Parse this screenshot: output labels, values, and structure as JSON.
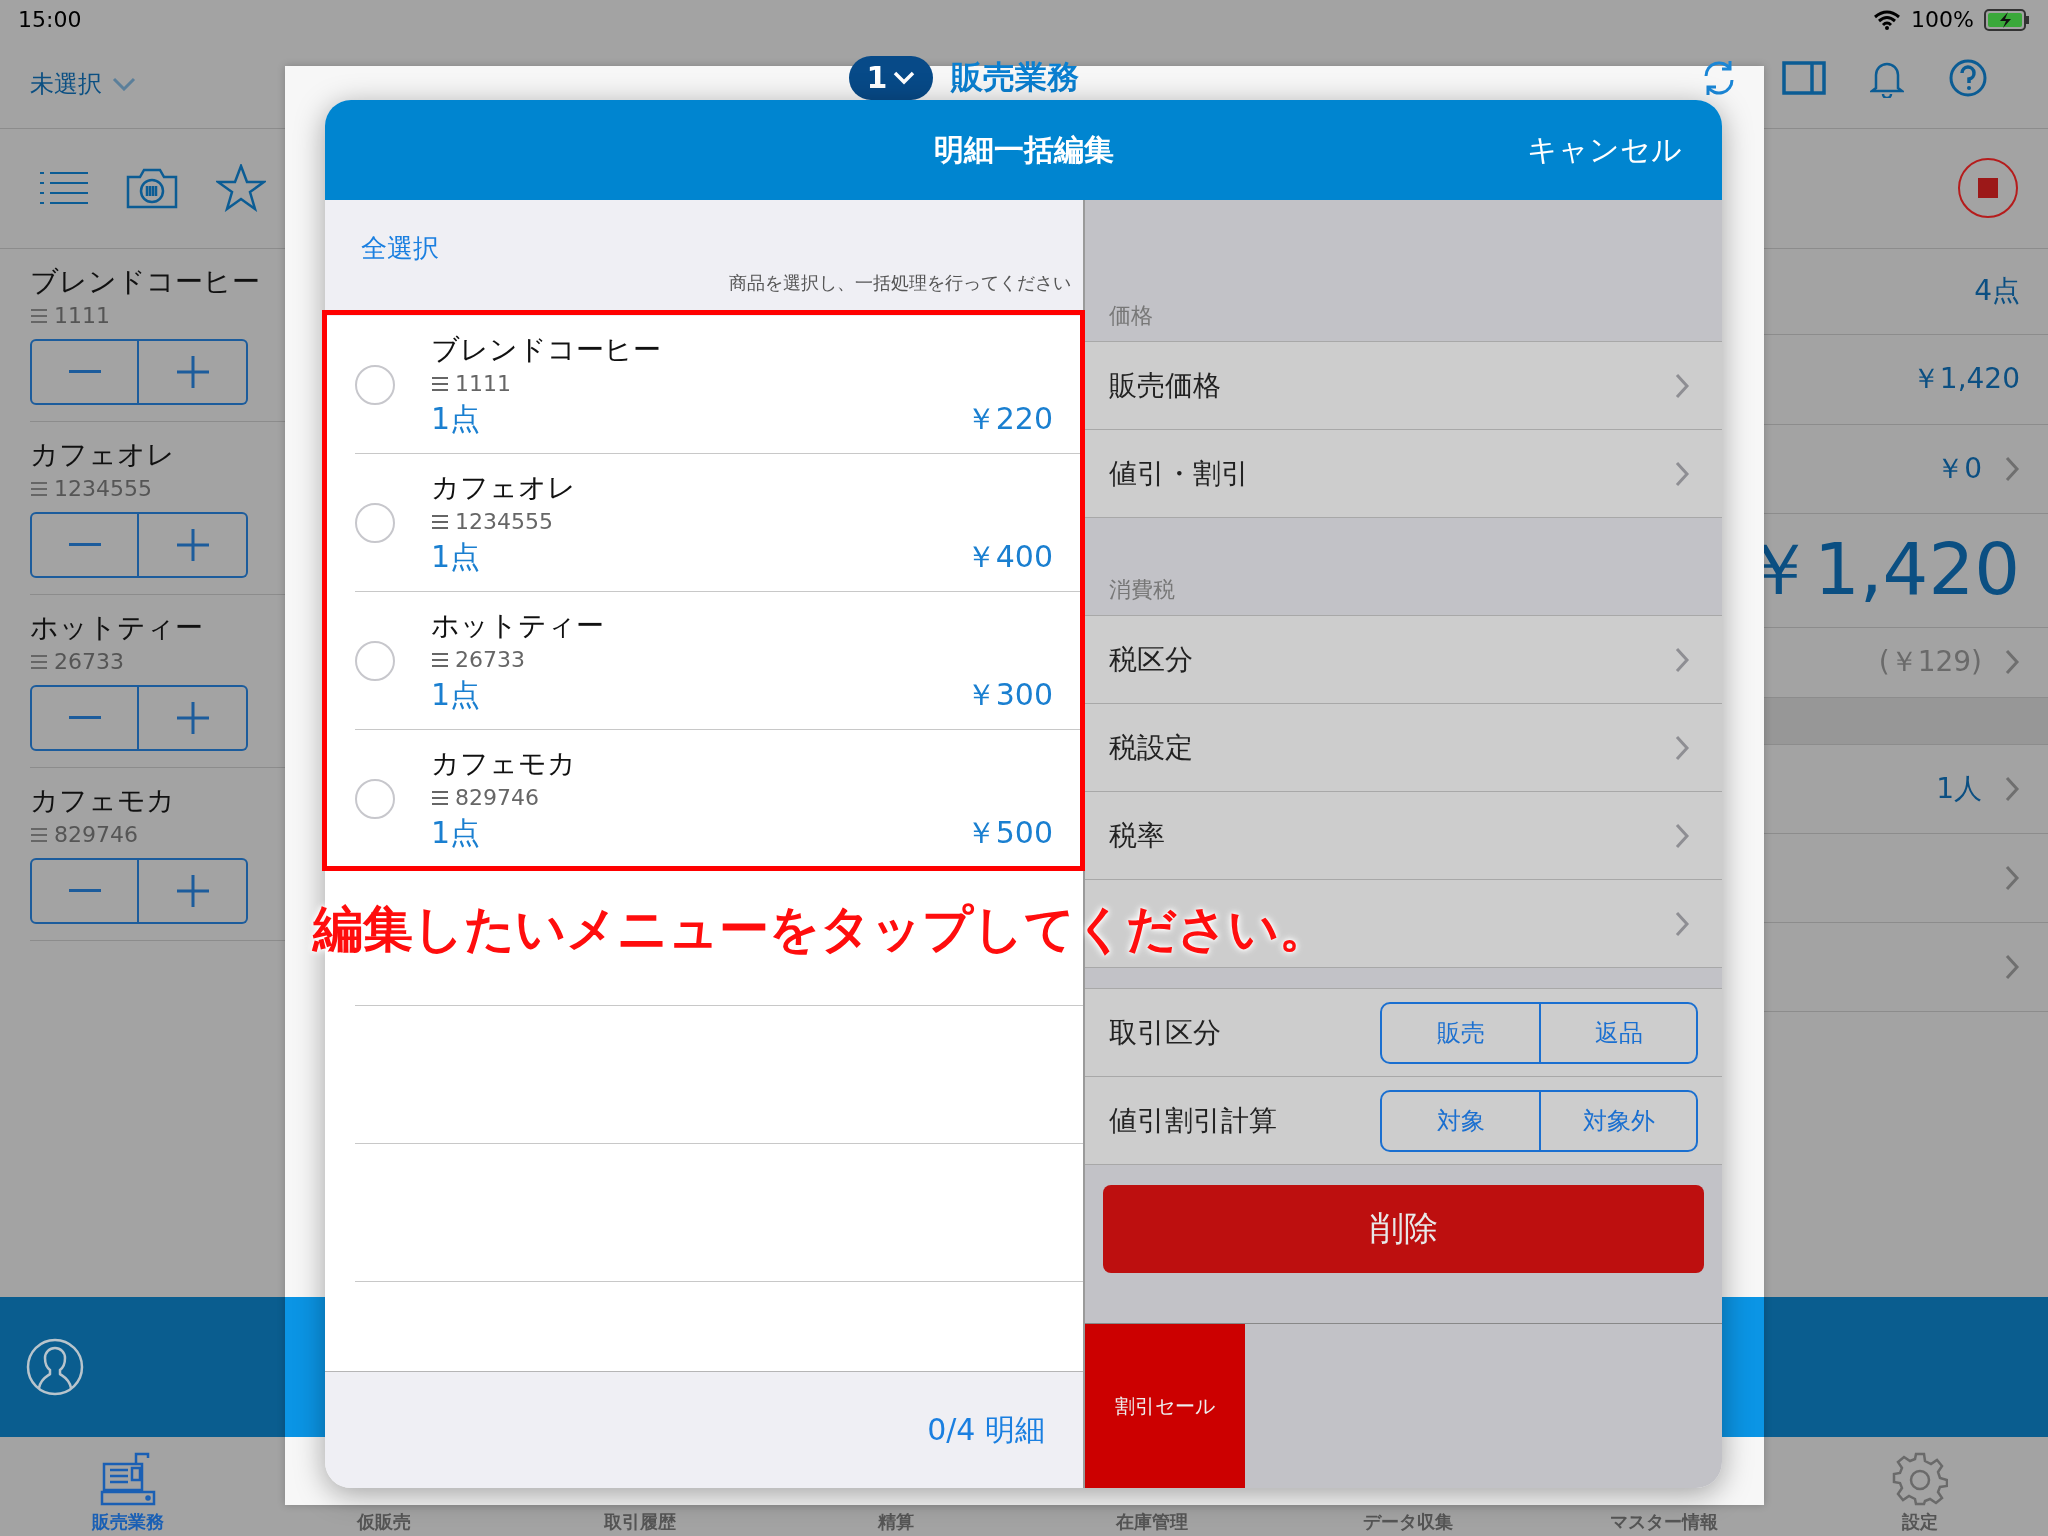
{
  "status_bar": {
    "time": "15:00",
    "battery": "100%"
  },
  "header": {
    "store": "未選択",
    "register_number": "1",
    "title": "販売業務"
  },
  "cart_items": [
    {
      "name": "ブレンドコーヒー",
      "code": "1111"
    },
    {
      "name": "カフェオレ",
      "code": "1234555"
    },
    {
      "name": "ホットティー",
      "code": "26733"
    },
    {
      "name": "カフェモカ",
      "code": "829746"
    }
  ],
  "summary": [
    {
      "kind": "count",
      "value": "4点"
    },
    {
      "kind": "amount",
      "value": "￥1,420"
    },
    {
      "kind": "link",
      "value": "￥0"
    },
    {
      "kind": "total",
      "value": "￥1,420"
    },
    {
      "kind": "tax",
      "value": "(￥129)"
    },
    {
      "kind": "band"
    },
    {
      "kind": "link",
      "value": "1人"
    },
    {
      "kind": "link"
    },
    {
      "kind": "link"
    }
  ],
  "modal": {
    "title": "明細一括編集",
    "cancel": "キャンセル",
    "select_all": "全選択",
    "hint": "商品を選択し、一括処理を行ってください",
    "items": [
      {
        "name": "ブレンドコーヒー",
        "code": "1111",
        "quantity": "1点",
        "price": "￥220",
        "selected": false
      },
      {
        "name": "カフェオレ",
        "code": "1234555",
        "quantity": "1点",
        "price": "￥400",
        "selected": false
      },
      {
        "name": "ホットティー",
        "code": "26733",
        "quantity": "1点",
        "price": "￥300",
        "selected": false
      },
      {
        "name": "カフェモカ",
        "code": "829746",
        "quantity": "1点",
        "price": "￥500",
        "selected": false
      }
    ],
    "footer": "0/4 明細",
    "sections": [
      {
        "title": "価格",
        "rows": [
          {
            "label": "販売価格"
          },
          {
            "label": "値引・割引"
          }
        ]
      },
      {
        "title": "消費税",
        "rows": [
          {
            "label": "税区分"
          },
          {
            "label": "税設定"
          },
          {
            "label": "税率"
          },
          {}
        ]
      }
    ],
    "toggles": [
      {
        "label": "取引区分",
        "options": [
          {
            "label": "販売",
            "selected": false
          },
          {
            "label": "返品",
            "selected": false
          }
        ]
      },
      {
        "label": "値引割引計算",
        "options": [
          {
            "label": "対象",
            "selected": false
          },
          {
            "label": "対象外",
            "selected": false
          }
        ]
      }
    ],
    "delete_button": "削除",
    "presets": [
      {
        "label": "割引セール"
      }
    ]
  },
  "annotation": {
    "text": "編集したいメニューをタップしてください。"
  },
  "tab_bar": [
    {
      "label": "販売業務",
      "kind": "register",
      "selected": true
    },
    {
      "label": "仮販売",
      "selected": false
    },
    {
      "label": "取引履歴",
      "selected": false
    },
    {
      "label": "精算",
      "selected": false
    },
    {
      "label": "在庫管理",
      "selected": false
    },
    {
      "label": "データ収集",
      "selected": false
    },
    {
      "label": "マスター情報",
      "selected": false
    },
    {
      "label": "設定",
      "kind": "settings",
      "selected": false
    }
  ]
}
